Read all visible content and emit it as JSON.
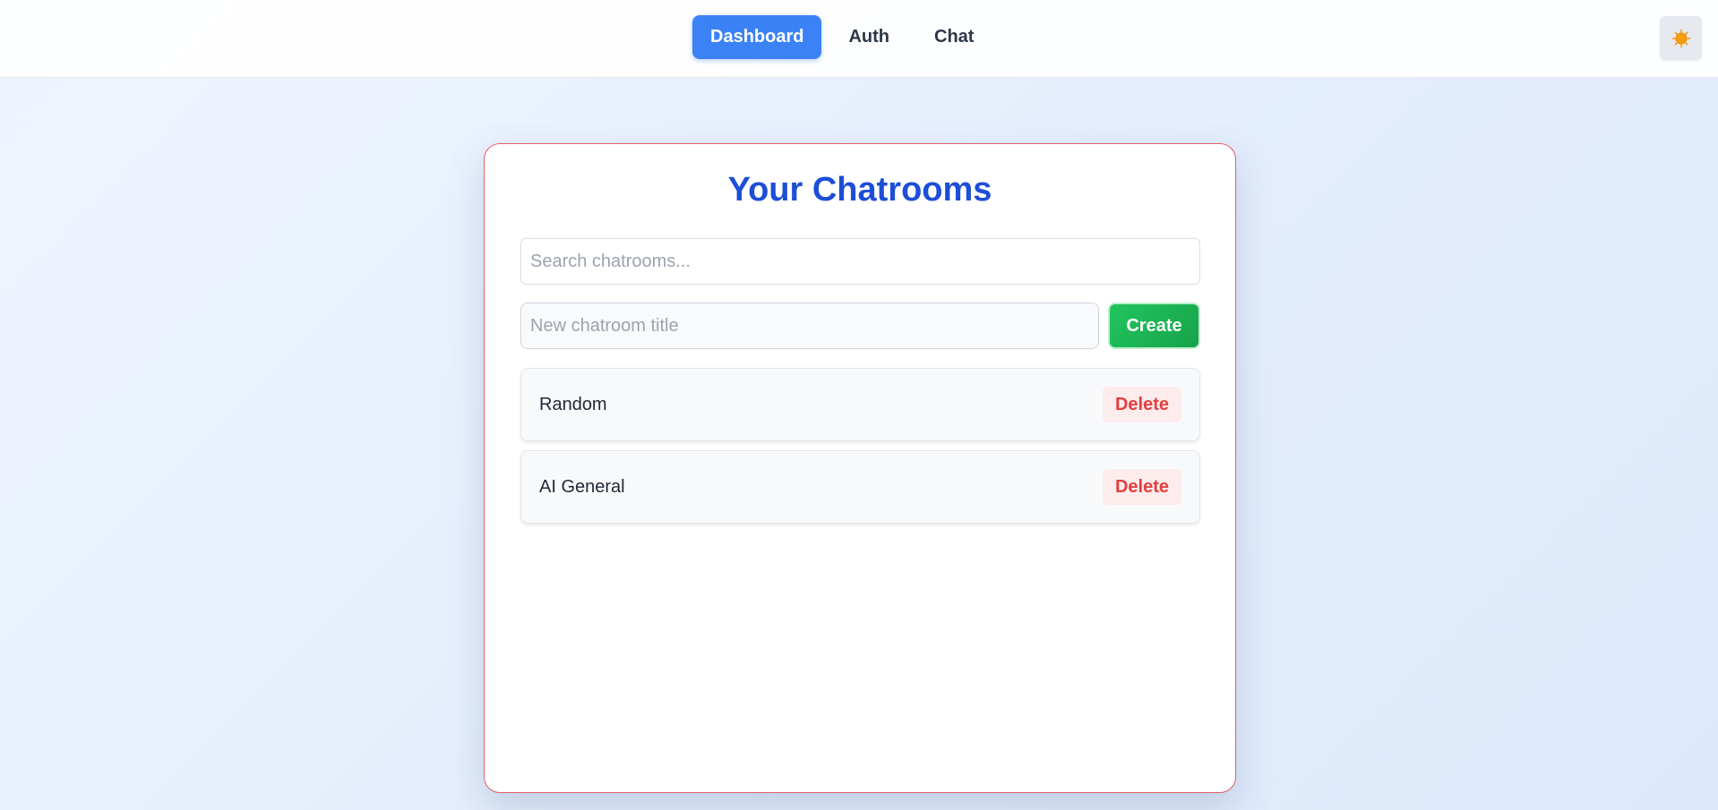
{
  "nav": {
    "links": [
      {
        "label": "Dashboard",
        "active": true
      },
      {
        "label": "Auth",
        "active": false
      },
      {
        "label": "Chat",
        "active": false
      }
    ],
    "theme_toggle_icon": "sun-icon"
  },
  "main": {
    "title": "Your Chatrooms",
    "search": {
      "placeholder": "Search chatrooms...",
      "value": ""
    },
    "new_room": {
      "placeholder": "New chatroom title",
      "value": ""
    },
    "create_label": "Create",
    "rooms": [
      {
        "name": "Random",
        "delete_label": "Delete"
      },
      {
        "name": "AI General",
        "delete_label": "Delete"
      }
    ]
  },
  "colors": {
    "primary": "#3b82f6",
    "title": "#1d4ed8",
    "create": "#22c55e",
    "delete_text": "#e53e3e",
    "delete_bg": "#fdecec",
    "card_border": "#e25d6a"
  }
}
